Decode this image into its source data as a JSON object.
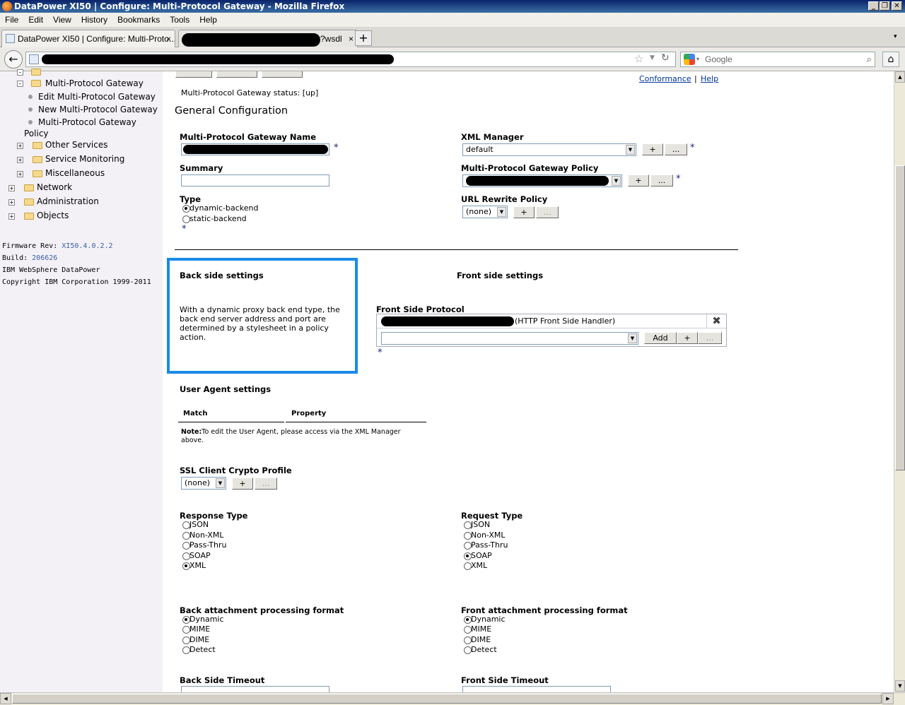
{
  "window": {
    "title": "DataPower XI50 | Configure: Multi-Protocol Gateway - Mozilla Firefox"
  },
  "menu": [
    "File",
    "Edit",
    "View",
    "History",
    "Bookmarks",
    "Tools",
    "Help"
  ],
  "tabs": [
    {
      "label": "DataPower XI50 | Configure: Multi-Proto..."
    },
    {
      "label": "?wsdl"
    }
  ],
  "search": {
    "placeholder": "Google"
  },
  "sidebar": {
    "items": [
      {
        "label": "Multi-Protocol Gateway"
      },
      {
        "label": "Edit Multi-Protocol Gateway"
      },
      {
        "label": "New Multi-Protocol Gateway"
      },
      {
        "label": "Multi-Protocol Gateway"
      },
      {
        "label": "Policy"
      },
      {
        "label": "Other Services"
      },
      {
        "label": "Service Monitoring"
      },
      {
        "label": "Miscellaneous"
      },
      {
        "label": "Network"
      },
      {
        "label": "Administration"
      },
      {
        "label": "Objects"
      }
    ],
    "firmware_label": "Firmware Rev:",
    "firmware_value": "XI50.4.0.2.2",
    "build_label": "Build:",
    "build_value": "206626",
    "product": "IBM WebSphere DataPower",
    "copyright": "Copyright IBM Corporation 1999-2011"
  },
  "toplinks": {
    "conformance": "Conformance",
    "help": "Help",
    "sep": "|"
  },
  "status": "Multi-Protocol Gateway status: [up]",
  "section_title": "General Configuration",
  "fields": {
    "name_label": "Multi-Protocol Gateway Name",
    "summary_label": "Summary",
    "type_label": "Type",
    "type_options": [
      "dynamic-backend",
      "static-backend"
    ],
    "xml_manager_label": "XML Manager",
    "xml_manager_value": "default",
    "policy_label": "Multi-Protocol Gateway Policy",
    "url_rewrite_label": "URL Rewrite Policy",
    "url_rewrite_value": "(none)"
  },
  "backside": {
    "title": "Back side settings",
    "description": "With a dynamic proxy back end type, the back end server address and port are determined by a stylesheet in a policy action."
  },
  "frontside": {
    "title": "Front side settings",
    "protocol_label": "Front Side Protocol",
    "protocol_entry": "(HTTP Front Side Handler)",
    "add_label": "Add"
  },
  "useragent": {
    "title": "User Agent settings",
    "col_match": "Match",
    "col_property": "Property",
    "note_bold": "Note:",
    "note_line1": "To edit the User Agent, please access via the XML Manager",
    "note_line2": "above."
  },
  "ssl": {
    "label": "SSL Client Crypto Profile",
    "value": "(none)"
  },
  "response_type": {
    "label": "Response Type",
    "options": [
      "JSON",
      "Non-XML",
      "Pass-Thru",
      "SOAP",
      "XML"
    ]
  },
  "request_type": {
    "label": "Request Type",
    "options": [
      "JSON",
      "Non-XML",
      "Pass-Thru",
      "SOAP",
      "XML"
    ]
  },
  "back_attach": {
    "label": "Back attachment processing format",
    "options": [
      "Dynamic",
      "MIME",
      "DIME",
      "Detect"
    ]
  },
  "front_attach": {
    "label": "Front attachment processing format",
    "options": [
      "Dynamic",
      "MIME",
      "DIME",
      "Detect"
    ]
  },
  "timeouts": {
    "back": "Back Side Timeout",
    "front": "Front Side Timeout"
  },
  "common": {
    "plus": "+",
    "ellipsis": "...",
    "star": "*"
  }
}
